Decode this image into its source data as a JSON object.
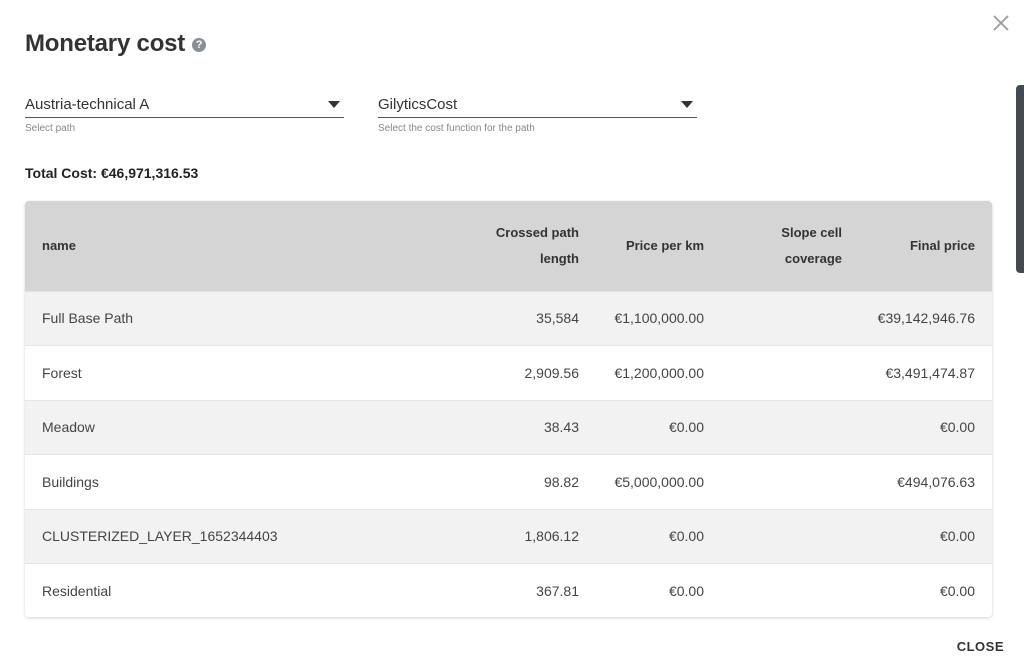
{
  "dialog": {
    "title": "Monetary cost",
    "help_icon": "?",
    "close_label": "CLOSE"
  },
  "path_select": {
    "value": "Austria-technical A",
    "hint": "Select path"
  },
  "cost_function_select": {
    "value": "GilyticsCost",
    "hint": "Select the cost function for the path"
  },
  "total": "Total Cost: €46,971,316.53",
  "table": {
    "headers": {
      "name": "name",
      "crossed_line1": "Crossed path",
      "crossed_line2": "length",
      "price_per_km": "Price per km",
      "slope_line1": "Slope cell",
      "slope_line2": "coverage",
      "final_price": "Final price"
    },
    "rows": [
      {
        "name": "Full Base Path",
        "length": "35,584",
        "price_per_km": "€1,100,000.00",
        "slope": "",
        "final_price": "€39,142,946.76"
      },
      {
        "name": "Forest",
        "length": "2,909.56",
        "price_per_km": "€1,200,000.00",
        "slope": "",
        "final_price": "€3,491,474.87"
      },
      {
        "name": "Meadow",
        "length": "38.43",
        "price_per_km": "€0.00",
        "slope": "",
        "final_price": "€0.00"
      },
      {
        "name": "Buildings",
        "length": "98.82",
        "price_per_km": "€5,000,000.00",
        "slope": "",
        "final_price": "€494,076.63"
      },
      {
        "name": "CLUSTERIZED_LAYER_1652344403",
        "length": "1,806.12",
        "price_per_km": "€0.00",
        "slope": "",
        "final_price": "€0.00"
      },
      {
        "name": "Residential",
        "length": "367.81",
        "price_per_km": "€0.00",
        "slope": "",
        "final_price": "€0.00"
      }
    ]
  }
}
